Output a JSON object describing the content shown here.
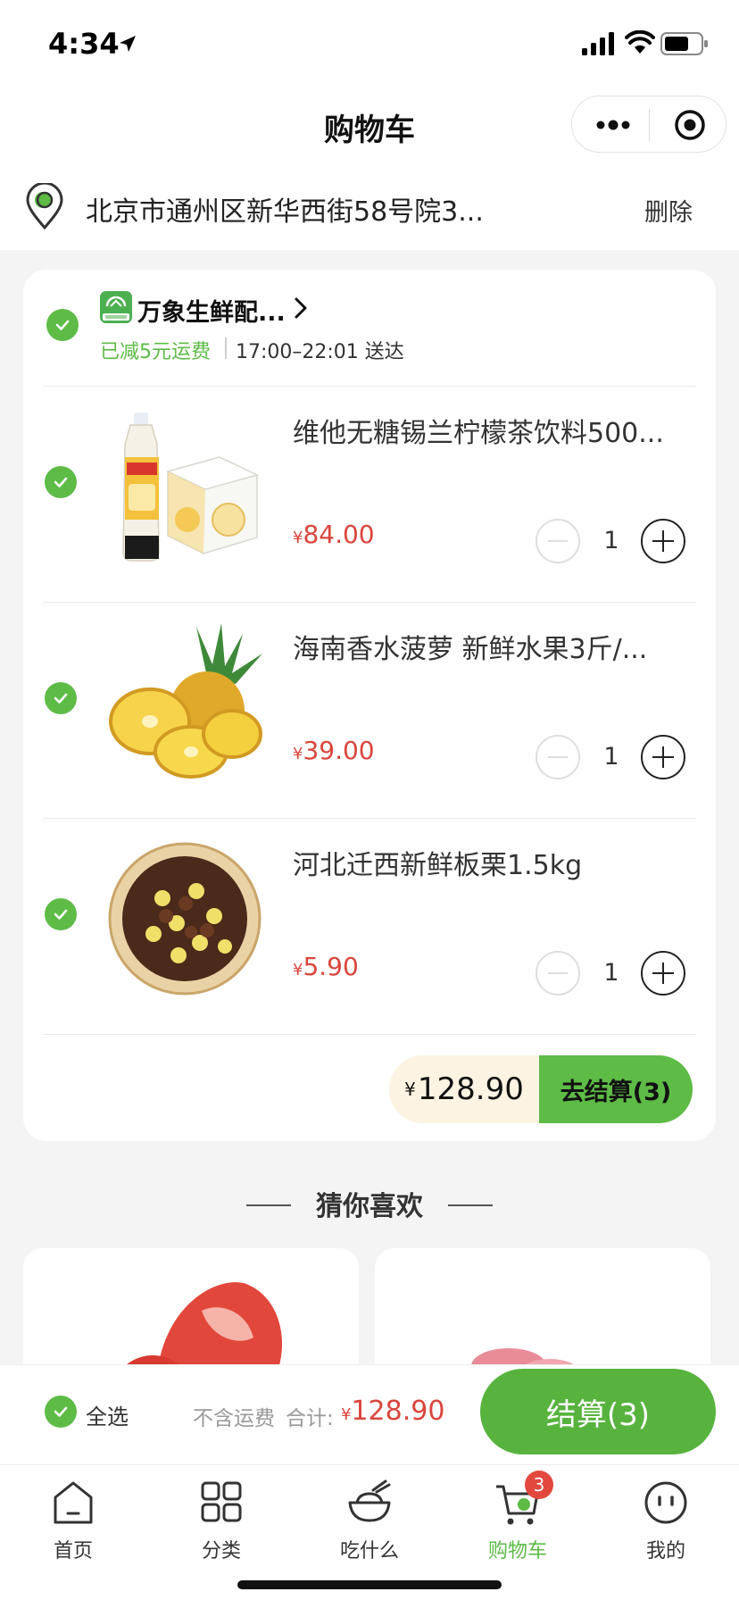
{
  "status_bar": {
    "time": "4:34"
  },
  "nav": {
    "title": "购物车"
  },
  "address": {
    "text": "北京市通州区新华西街58号院3...",
    "delete_label": "删除"
  },
  "shop": {
    "name": "万象生鲜配...",
    "promo": "已减5元运费",
    "delivery": "17:00–22:01 送达",
    "logo_text": "万象生鲜"
  },
  "cart": {
    "items": [
      {
        "name": "维他无糖锡兰柠檬茶饮料500...",
        "currency": "¥",
        "price": "84.00",
        "quantity": "1"
      },
      {
        "name": "海南香水菠萝 新鲜水果3斤/...",
        "currency": "¥",
        "price": "39.00",
        "quantity": "1"
      },
      {
        "name": "河北迁西新鲜板栗1.5kg",
        "currency": "¥",
        "price": "5.90",
        "quantity": "1"
      }
    ],
    "total_currency": "¥",
    "total": "128.90",
    "checkout_label": "去结算(3)"
  },
  "recommend": {
    "title": "猜你喜欢"
  },
  "bottom_bar": {
    "select_all": "全选",
    "shipping_note": "不含运费",
    "total_label": "合计:",
    "total_currency": "¥",
    "total": "128.90",
    "pay_label": "结算(3)"
  },
  "tabs": [
    {
      "label": "首页",
      "icon": "home-icon"
    },
    {
      "label": "分类",
      "icon": "grid-icon"
    },
    {
      "label": "吃什么",
      "icon": "bowl-icon"
    },
    {
      "label": "购物车",
      "icon": "cart-icon",
      "badge": "3",
      "active": true
    },
    {
      "label": "我的",
      "icon": "profile-icon"
    }
  ],
  "colors": {
    "accent": "#5dbb46",
    "price": "#d9463d",
    "badge": "#e2483d",
    "pill_bg": "#fdf3e2"
  }
}
